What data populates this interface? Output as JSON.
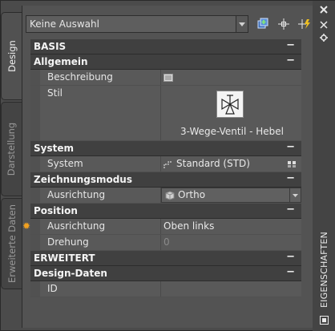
{
  "tabs": [
    {
      "label": "Design",
      "active": true
    },
    {
      "label": "Darstellung",
      "active": false
    },
    {
      "label": "Erweiterte Daten",
      "active": false
    }
  ],
  "selector": {
    "value": "Keine Auswahl"
  },
  "toolbar_icons": [
    "add-selection-icon",
    "select-objects-icon",
    "quick-select-icon"
  ],
  "panel_title": "EIGENSCHAFTEN",
  "window_icons": [
    "close-icon",
    "auto-hide-icon",
    "properties-menu-icon",
    "panel-options-icon"
  ],
  "collapse_symbol": "−",
  "grid": {
    "basis": {
      "label": "BASIS"
    },
    "allgemein": {
      "label": "Allgemein",
      "beschreibung": "Beschreibung",
      "stil": "Stil",
      "stil_value": "3-Wege-Ventil - Hebel"
    },
    "system": {
      "label": "System",
      "row_label": "System",
      "row_value": "Standard (STD)"
    },
    "zeichnungsmodus": {
      "label": "Zeichnungsmodus",
      "row_label": "Ausrichtung",
      "row_value": "Ortho"
    },
    "position": {
      "label": "Position",
      "ausrichtung": "Ausrichtung",
      "ausrichtung_value": "Oben links",
      "drehung": "Drehung",
      "drehung_value": "0"
    },
    "erweitert": {
      "label": "ERWEITERT"
    },
    "design_daten": {
      "label": "Design-Daten",
      "id_label": "ID"
    }
  }
}
